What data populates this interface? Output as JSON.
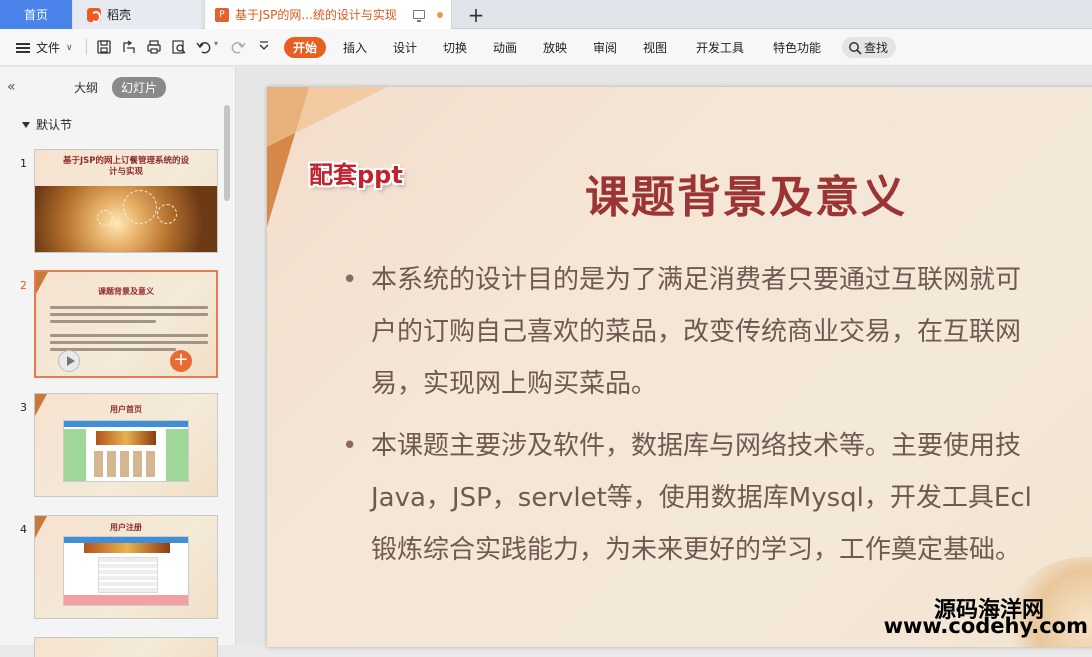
{
  "tabs": {
    "home": "首页",
    "daoke": "稻壳",
    "document": "基于JSP的网...统的设计与实现",
    "add": "+"
  },
  "menu": {
    "file": "文件",
    "items": [
      "开始",
      "插入",
      "设计",
      "切换",
      "动画",
      "放映",
      "审阅",
      "视图",
      "开发工具",
      "特色功能"
    ],
    "search": "查找"
  },
  "panel": {
    "view_outline": "大纲",
    "view_slides": "幻灯片",
    "section": "默认节",
    "thumbnails": [
      {
        "num": "1",
        "title": "基于JSP的网上订餐管理系统的设计与实现"
      },
      {
        "num": "2",
        "title": "课题背景及意义"
      },
      {
        "num": "3",
        "title": "用户首页"
      },
      {
        "num": "4",
        "title": "用户注册"
      }
    ]
  },
  "slide": {
    "badge": "配套ppt",
    "title": "课题背景及意义",
    "bullets": [
      {
        "lines": [
          "本系统的设计目的是为了满足消费者只要通过互联网就可",
          "户的订购自己喜欢的菜品，改变传统商业交易，在互联网",
          "易，实现网上购买菜品。"
        ]
      },
      {
        "lines": [
          "本课题主要涉及软件，数据库与网络技术等。主要使用技",
          "Java，JSP，servlet等，使用数据库Mysql，开发工具Ecl",
          "锻炼综合实践能力，为未来更好的学习，工作奠定基础。"
        ]
      }
    ]
  },
  "watermark": {
    "line1": "源码海洋网",
    "line2": "www.codehy.com"
  },
  "colors": {
    "accent": "#e85f22",
    "home_tab": "#4a83ea",
    "title": "#9b3535"
  }
}
